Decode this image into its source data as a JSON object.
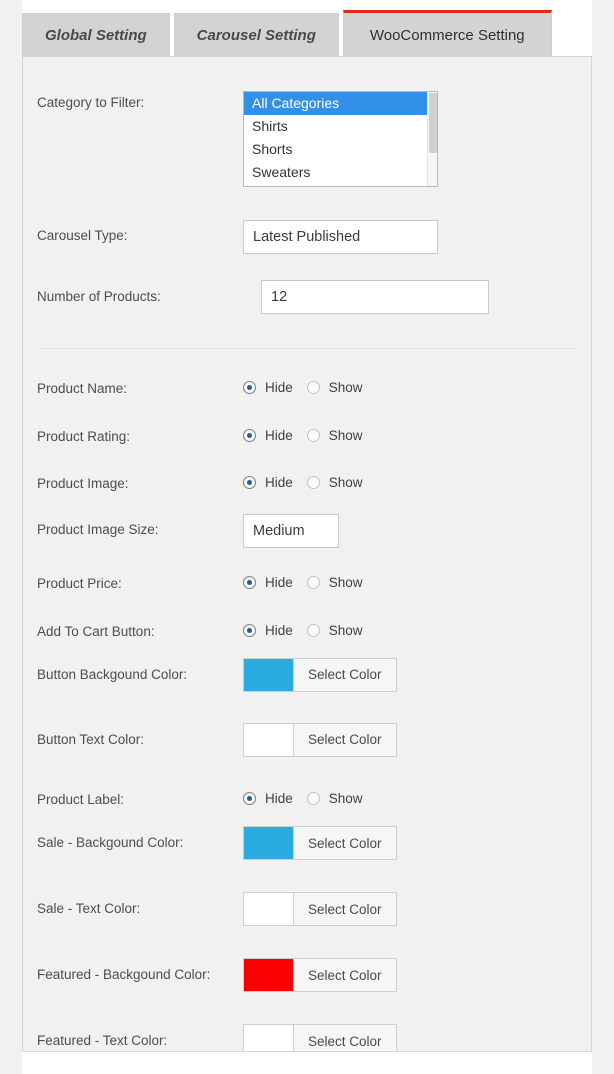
{
  "tabs": [
    {
      "label": "Global Setting",
      "active": false
    },
    {
      "label": "Carousel Setting",
      "active": false
    },
    {
      "label": "WooCommerce Setting",
      "active": true
    }
  ],
  "accent": {
    "active_tab_underline": "#e02b20",
    "select_highlight": "#3390e8",
    "radio_checked": "#1b5f9e"
  },
  "fields": {
    "category_to_filter": {
      "label": "Category to Filter:",
      "options": [
        "All Categories",
        "Shirts",
        "Shorts",
        "Sweaters"
      ],
      "selected": "All Categories"
    },
    "carousel_type": {
      "label": "Carousel Type:",
      "value": "Latest Published"
    },
    "number_of_products": {
      "label": "Number of Products:",
      "value": "12"
    },
    "product_name": {
      "label": "Product Name:",
      "hide_label": "Hide",
      "show_label": "Show",
      "selected": "Hide"
    },
    "product_rating": {
      "label": "Product Rating:",
      "hide_label": "Hide",
      "show_label": "Show",
      "selected": "Hide"
    },
    "product_image": {
      "label": "Product Image:",
      "hide_label": "Hide",
      "show_label": "Show",
      "selected": "Hide"
    },
    "product_image_size": {
      "label": "Product Image Size:",
      "value": "Medium"
    },
    "product_price": {
      "label": "Product Price:",
      "hide_label": "Hide",
      "show_label": "Show",
      "selected": "Hide"
    },
    "add_to_cart_button": {
      "label": "Add To Cart Button:",
      "hide_label": "Hide",
      "show_label": "Show",
      "selected": "Hide"
    },
    "button_background_color": {
      "label": "Button Backgound Color:",
      "button_label": "Select Color",
      "color": "#29abdd"
    },
    "button_text_color": {
      "label": "Button Text Color:",
      "button_label": "Select Color",
      "color": "#ffffff"
    },
    "product_label": {
      "label": "Product Label:",
      "hide_label": "Hide",
      "show_label": "Show",
      "selected": "Hide"
    },
    "sale_background_color": {
      "label": "Sale - Backgound Color:",
      "button_label": "Select Color",
      "color": "#29abdd"
    },
    "sale_text_color": {
      "label": "Sale - Text Color:",
      "button_label": "Select Color",
      "color": "#ffffff"
    },
    "featured_background_color": {
      "label": "Featured - Backgound Color:",
      "button_label": "Select Color",
      "color": "#fa0000"
    },
    "featured_text_color": {
      "label": "Featured - Text Color:",
      "button_label": "Select Color",
      "color": "#ffffff"
    }
  }
}
